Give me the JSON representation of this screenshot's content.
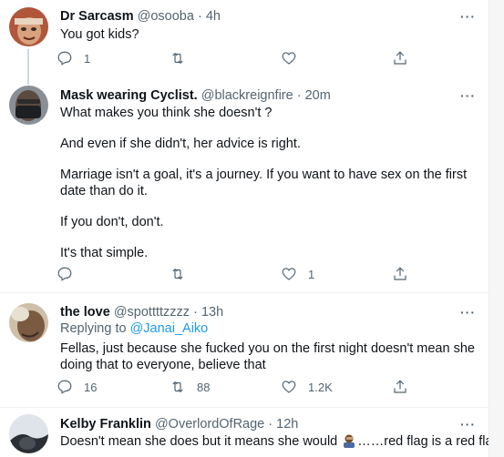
{
  "tweets": [
    {
      "name": "Dr Sarcasm",
      "handle": "@osooba",
      "dot": "·",
      "time": "4h",
      "lines": [
        "You got kids?"
      ],
      "actions": {
        "reply": "1",
        "retweet": "",
        "like": ""
      }
    },
    {
      "name": "Mask wearing Cyclist.",
      "handle": "@blackreignfire",
      "dot": "·",
      "time": "20m",
      "lines": [
        "What makes you think she doesn't ?",
        "And even if she didn't, her advice is right.",
        "Marriage isn't a goal, it's a journey. If you want to have sex on the first date than do it.",
        "If you don't, don't.",
        "It's that simple."
      ],
      "actions": {
        "reply": "",
        "retweet": "",
        "like": "1"
      }
    },
    {
      "name": "the love",
      "handle": "@spottttzzzz",
      "dot": "·",
      "time": "13h",
      "replying_prefix": "Replying to ",
      "replying_to": "@Janai_Aiko",
      "lines": [
        "Fellas, just because she fucked you on the first night doesn't mean she doing that to everyone, believe that"
      ],
      "actions": {
        "reply": "16",
        "retweet": "88",
        "like": "1.2K"
      }
    },
    {
      "name": "Kelby Franklin",
      "handle": "@OverlordOfRage",
      "dot": "·",
      "time": "12h",
      "text_before_emoji": "Doesn't mean she does but it means she would",
      "emoji": "man-facepalming-emoji",
      "text_after_emoji": "……red flag is a red flag"
    }
  ],
  "more_label": "···",
  "icons": {
    "reply": "reply-icon",
    "retweet": "retweet-icon",
    "like": "heart-icon",
    "share": "share-icon"
  }
}
